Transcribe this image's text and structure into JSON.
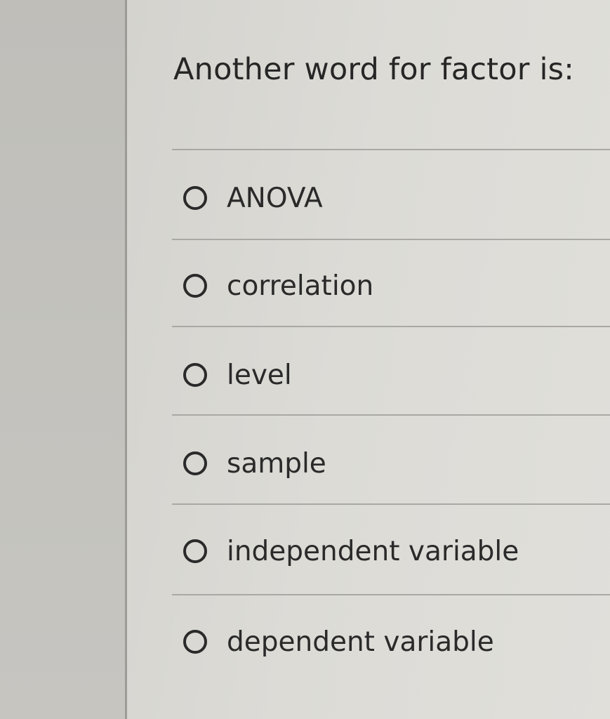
{
  "question": {
    "text": "Another word for factor is:"
  },
  "options": [
    {
      "label": "ANOVA"
    },
    {
      "label": "correlation"
    },
    {
      "label": "level"
    },
    {
      "label": "sample"
    },
    {
      "label": "independent variable"
    },
    {
      "label": "dependent variable"
    }
  ]
}
